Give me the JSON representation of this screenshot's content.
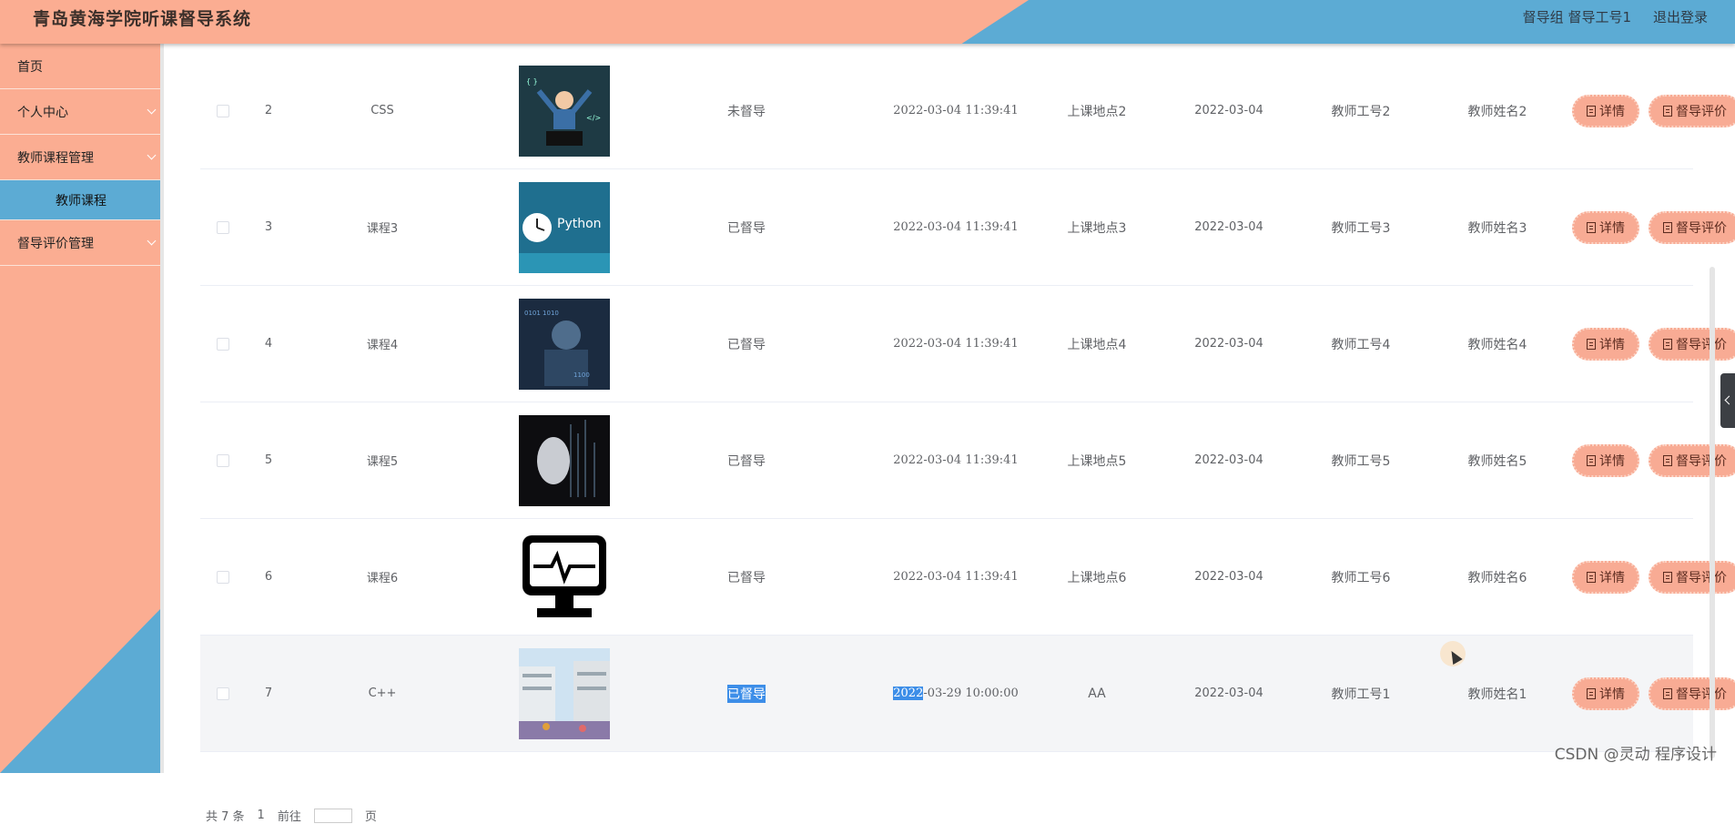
{
  "header": {
    "title": "青岛黄海学院听课督导系统",
    "role_user": "督导组  督导工号1",
    "logout": "退出登录"
  },
  "sidebar": {
    "items": [
      {
        "label": "首页"
      },
      {
        "label": "个人中心"
      },
      {
        "label": "教师课程管理"
      },
      {
        "label": "教师课程"
      },
      {
        "label": "督导评价管理"
      }
    ]
  },
  "buttons": {
    "detail": "详情",
    "evaluate": "督导评价"
  },
  "rows": [
    {
      "idx": "2",
      "name": "CSS",
      "status": "未督导",
      "time": "2022-03-04 11:39:41",
      "place": "上课地点2",
      "date": "2022-03-04",
      "tno": "教师工号2",
      "tname": "教师姓名2"
    },
    {
      "idx": "3",
      "name": "课程3",
      "status": "已督导",
      "time": "2022-03-04 11:39:41",
      "place": "上课地点3",
      "date": "2022-03-04",
      "tno": "教师工号3",
      "tname": "教师姓名3"
    },
    {
      "idx": "4",
      "name": "课程4",
      "status": "已督导",
      "time": "2022-03-04 11:39:41",
      "place": "上课地点4",
      "date": "2022-03-04",
      "tno": "教师工号4",
      "tname": "教师姓名4"
    },
    {
      "idx": "5",
      "name": "课程5",
      "status": "已督导",
      "time": "2022-03-04 11:39:41",
      "place": "上课地点5",
      "date": "2022-03-04",
      "tno": "教师工号5",
      "tname": "教师姓名5"
    },
    {
      "idx": "6",
      "name": "课程6",
      "status": "已督导",
      "time": "2022-03-04 11:39:41",
      "place": "上课地点6",
      "date": "2022-03-04",
      "tno": "教师工号6",
      "tname": "教师姓名6"
    },
    {
      "idx": "7",
      "name": "C++",
      "status": "已督导",
      "time_sel": "2022",
      "time_rest": "-03-29 10:00:00",
      "place": "AA",
      "date": "2022-03-04",
      "tno": "教师工号1",
      "tname": "教师姓名1"
    }
  ],
  "pager": {
    "total": "共 7 条",
    "page": "1",
    "goto": "前往",
    "unit": "页"
  },
  "watermark": "CSDN @灵动 程序设计",
  "colors": {
    "header_salmon": "#fbad92",
    "header_blue": "#5cabd4",
    "button": "#f8ab94"
  },
  "icons": [
    "chevron-down-icon",
    "document-icon",
    "collapse-arrow-icon"
  ]
}
